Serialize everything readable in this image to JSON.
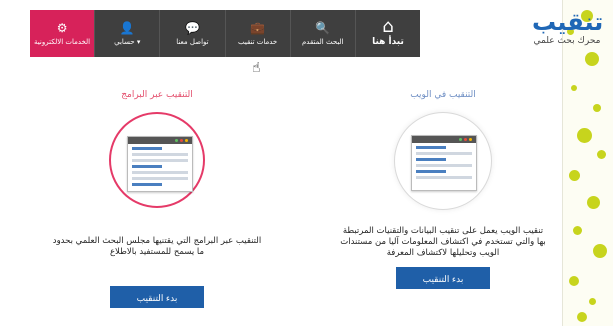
{
  "logo": {
    "brand": "تنقيب",
    "tagline": "محرك بحث علمي"
  },
  "nav": {
    "home": {
      "label": "تبدأ هنا",
      "icon": "home-icon"
    },
    "advanced_search": {
      "label": "البحث المتقدم",
      "icon": "search-icon"
    },
    "mining_services": {
      "label": "خدمات تنقيب",
      "icon": "briefcase-icon"
    },
    "contact": {
      "label": "تواصل معنا",
      "icon": "chat-icon"
    },
    "account": {
      "label": "حسابي ▾",
      "icon": "user-icon"
    },
    "e_services": {
      "label": "الخدمات الالكترونية",
      "icon": "gear-icon"
    }
  },
  "web_panel": {
    "title": "التنقيب في الويب",
    "description": "تنقيب الويب يعمل على تنقيب البيانات والتقنيات المرتبطة بها والتي تستخدم في اكتشاف المعلومات آليا من مستندات الويب وتحليلها لاكتشاف المعرفة",
    "button": "بدء التنقيب"
  },
  "programs_panel": {
    "title": "التنقيب عبر البرامج",
    "description": "التنقيب عبر البرامج التي يقتنيها مجلس البحث العلمي بحدود ما يسمح للمستفيد بالاطلاع",
    "button": "بدء التنقيب"
  },
  "colors": {
    "accent": "#d7225a",
    "nav_bg": "#3f3f3f",
    "button": "#1f5fa8",
    "brand": "#1f67b6",
    "dots": "#c7d41d"
  }
}
